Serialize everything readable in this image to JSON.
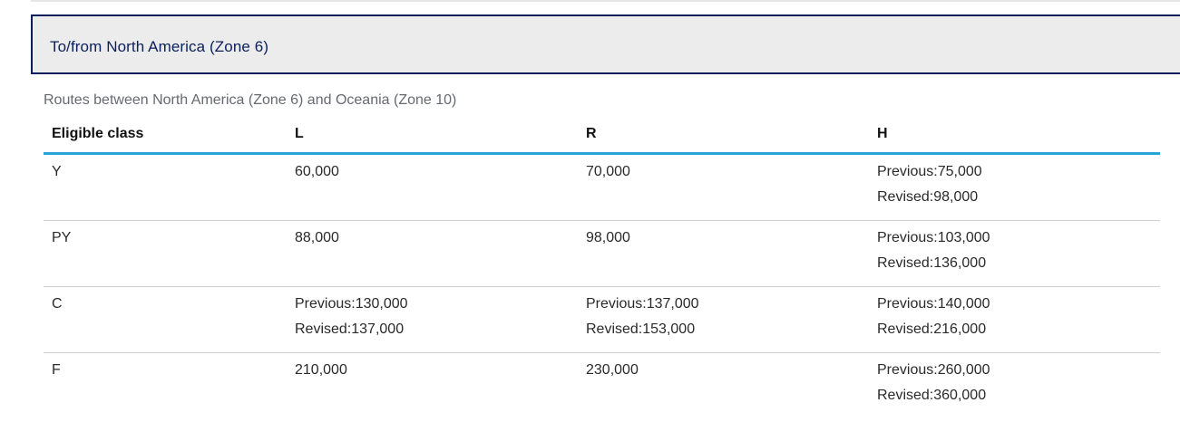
{
  "section": {
    "title": "To/from North America (Zone 6)"
  },
  "table": {
    "caption": "Routes between North America (Zone 6) and Oceania (Zone 10)",
    "headers": [
      "Eligible class",
      "L",
      "R",
      "H"
    ],
    "rows": [
      {
        "class": "Y",
        "L": [
          "60,000"
        ],
        "R": [
          "70,000"
        ],
        "H": [
          "Previous:75,000",
          "Revised:98,000"
        ]
      },
      {
        "class": "PY",
        "L": [
          "88,000"
        ],
        "R": [
          "98,000"
        ],
        "H": [
          "Previous:103,000",
          "Revised:136,000"
        ]
      },
      {
        "class": "C",
        "L": [
          "Previous:130,000",
          "Revised:137,000"
        ],
        "R": [
          "Previous:137,000",
          "Revised:153,000"
        ],
        "H": [
          "Previous:140,000",
          "Revised:216,000"
        ]
      },
      {
        "class": "F",
        "L": [
          "210,000"
        ],
        "R": [
          "230,000"
        ],
        "H": [
          "Previous:260,000",
          "Revised:360,000"
        ]
      }
    ]
  },
  "colors": {
    "header_border": "#0b1f5c",
    "header_bg": "#ececec",
    "table_accent": "#2aa3db"
  }
}
